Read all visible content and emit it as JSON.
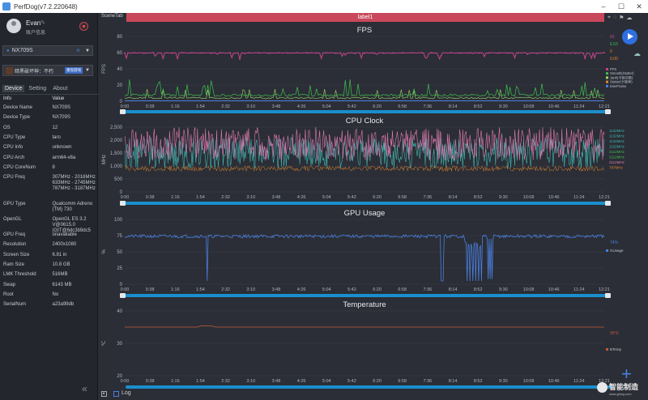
{
  "window": {
    "title": "PerfDog(v7.2.220648)"
  },
  "user": {
    "name": "Evan",
    "account": "账户信息"
  },
  "device_select": {
    "value": "NX709S"
  },
  "app_select": {
    "value": "暗黑破坏神：不朽",
    "badge": "重现游戏"
  },
  "tabs": [
    "Device",
    "Setting",
    "About"
  ],
  "info_header": {
    "k": "Info",
    "v": "Value"
  },
  "info": [
    {
      "k": "Device Name",
      "v": "NX709S"
    },
    {
      "k": "Device Type",
      "v": "NX709S"
    },
    {
      "k": "OS",
      "v": "12"
    },
    {
      "k": "CPU Type",
      "v": "taro"
    },
    {
      "k": "CPU Info",
      "v": "unknown"
    },
    {
      "k": "CPU Arch",
      "v": "arm64-v8a"
    },
    {
      "k": "CPU CoreNum",
      "v": "8"
    },
    {
      "k": "CPU Freq",
      "v": "307MHz - 2016MHz\n633MHz - 2745MHz\n787MHz - 3187MHz"
    },
    {
      "k": "GPU Type",
      "v": "Qualcomm Adreno (TM) 730"
    },
    {
      "k": "OpenGL",
      "v": "OpenGL ES 3.2 V@0615.0 (GIT@6dc3b9dc5"
    },
    {
      "k": "GPU Freq",
      "v": "unavailable"
    },
    {
      "k": "Resolution",
      "v": "2400x1080"
    },
    {
      "k": "Screen Size",
      "v": "6.81 in"
    },
    {
      "k": "Ram Size",
      "v": "10.8 GB"
    },
    {
      "k": "LMK Threshold",
      "v": "516MB"
    },
    {
      "k": "Swap",
      "v": "6143 MB"
    },
    {
      "k": "Root",
      "v": "No"
    },
    {
      "k": "SerialNum",
      "v": "a23a99db"
    }
  ],
  "scene_tab": "SceneTab",
  "label_tab": "label1",
  "bottom": {
    "log": "Log",
    "watermark": "智能制造",
    "watermark_sub": "www.yjbzg.com"
  },
  "x_ticks": [
    "0:00",
    "0:38",
    "1:16",
    "1:54",
    "2:32",
    "3:10",
    "3:48",
    "4:26",
    "5:04",
    "5:42",
    "6:20",
    "6:58",
    "7:36",
    "8:14",
    "8:52",
    "9:30",
    "10:08",
    "10:46",
    "11:24",
    "12:21"
  ],
  "colors": {
    "pink": "#c8448f",
    "green": "#3fbf4f",
    "lightgreen": "#9fd66a",
    "orange": "#e0852d",
    "blue": "#4a7fe0",
    "teal": "#3fb6b0",
    "cpupink": "#e07ab0",
    "temp": "#c45a3a"
  },
  "fps": {
    "title": "FPS",
    "ylabel": "FPS",
    "y_ticks": [
      "0",
      "20",
      "40",
      "60",
      "80"
    ],
    "readouts": [
      {
        "t": "60",
        "c": "#c8448f"
      },
      {
        "t": "6.63",
        "c": "#3fbf4f"
      },
      {
        "t": "0",
        "c": "#e0852d"
      },
      {
        "t": "0.00",
        "c": "#e0852d"
      }
    ],
    "legend": [
      "FPS",
      "Smooth(Stutter)",
      "Jank(卡顿次数)",
      "Stutter(卡顿率)",
      "InterFrame"
    ]
  },
  "cpu": {
    "title": "CPU Clock",
    "ylabel": "MHz",
    "y_ticks": [
      "0",
      "500",
      "1,000",
      "1,500",
      "2,000",
      "2,500"
    ],
    "readouts": [
      {
        "t": "1132MHz",
        "c": "#3fb6b0"
      },
      {
        "t": "1132MHz",
        "c": "#3fb6b0"
      },
      {
        "t": "1132MHz",
        "c": "#3fb6b0"
      },
      {
        "t": "1132MHz",
        "c": "#3fb6b0"
      },
      {
        "t": "2112MHz",
        "c": "#3fbf4f"
      },
      {
        "t": "2112MHz",
        "c": "#3fbf4f"
      },
      {
        "t": "2112MHz",
        "c": "#e07ab0"
      },
      {
        "t": "787MHz",
        "c": "#e0852d"
      }
    ]
  },
  "gpu": {
    "title": "GPU Usage",
    "ylabel": "%",
    "y_ticks": [
      "0",
      "25",
      "50",
      "75",
      "100"
    ],
    "readout": "74%",
    "legend": "GUsage"
  },
  "temp": {
    "title": "Temperature",
    "ylabel": "℃",
    "y_ticks": [
      "20",
      "30",
      "40"
    ],
    "readout": "35℃",
    "legend": "BTemp"
  },
  "chart_data": [
    {
      "type": "line",
      "title": "FPS",
      "ylabel": "FPS",
      "ylim": [
        0,
        80
      ],
      "series": [
        {
          "name": "FPS",
          "values": [
            60,
            60,
            60,
            60,
            59,
            60,
            60,
            60,
            60,
            60,
            58,
            60,
            60,
            60,
            55,
            60,
            60,
            60,
            60,
            60
          ]
        },
        {
          "name": "Smooth(Stutter)",
          "values": [
            6,
            8,
            5,
            22,
            6,
            7,
            5,
            9,
            6,
            7,
            8,
            6,
            7,
            5,
            9,
            6,
            8,
            6,
            7,
            6
          ]
        }
      ]
    },
    {
      "type": "line",
      "title": "CPU Clock",
      "ylabel": "MHz",
      "ylim": [
        0,
        2500
      ],
      "series": [
        {
          "name": "CPU",
          "values": [
            2100,
            1800,
            2300,
            1500,
            2200,
            1900,
            2400,
            1700,
            2100,
            2000,
            2300,
            1900,
            2200,
            1600,
            2300,
            2000,
            2200,
            1800,
            2200,
            2100
          ]
        }
      ]
    },
    {
      "type": "line",
      "title": "GPU Usage",
      "ylabel": "%",
      "ylim": [
        0,
        100
      ],
      "series": [
        {
          "name": "GUsage",
          "values": [
            75,
            74,
            76,
            75,
            73,
            75,
            76,
            74,
            75,
            75,
            74,
            76,
            75,
            50,
            75,
            74,
            75,
            74,
            75,
            74
          ]
        }
      ]
    },
    {
      "type": "line",
      "title": "Temperature",
      "ylabel": "℃",
      "ylim": [
        20,
        40
      ],
      "series": [
        {
          "name": "BTemp",
          "values": [
            35,
            35,
            35,
            35,
            35,
            35,
            35,
            35,
            35,
            35,
            35,
            35,
            35,
            35,
            35,
            35,
            35,
            35,
            35,
            35
          ]
        }
      ]
    }
  ]
}
